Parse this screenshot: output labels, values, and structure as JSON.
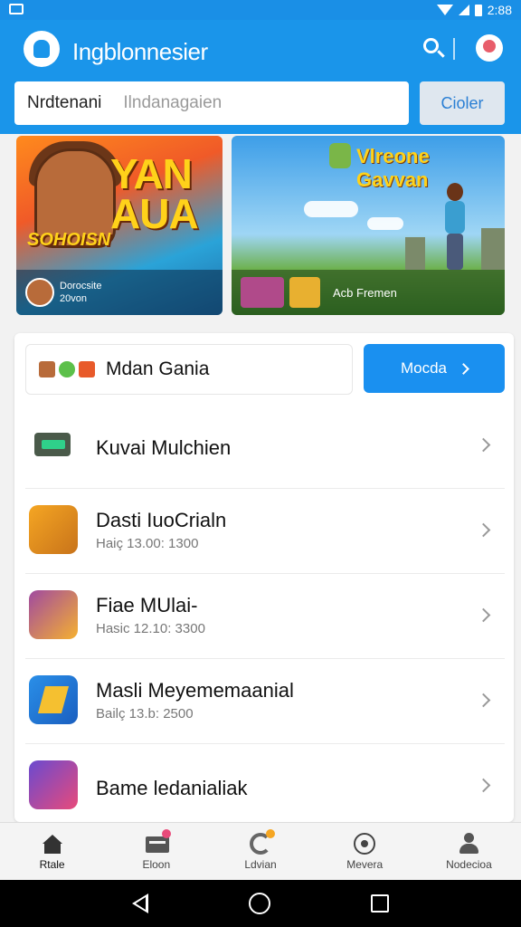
{
  "status_bar": {
    "time": "2:88"
  },
  "app_bar": {
    "title": "Ingblonnesier"
  },
  "search": {
    "label": "Nrdtenani",
    "placeholder": "Ilndanagaien",
    "clear_label": "Cioler"
  },
  "banners": [
    {
      "big_title": "YAN AUA",
      "sub_title": "SOHOISN",
      "stats": [
        "Dorocsite",
        "20von"
      ]
    },
    {
      "title": "Vlreone Gavvan",
      "caption": "Acb Fremen"
    }
  ],
  "feature": {
    "title": "Mdan Gania",
    "more_label": "Mocda"
  },
  "games": [
    {
      "name": "Kuvai Mulchien",
      "meta": ""
    },
    {
      "name": "Dasti IuoCrialn",
      "meta": "Haiç 13.00: 1300"
    },
    {
      "name": "Fiae MUlai-",
      "meta": "Hasic 12.10: 3300"
    },
    {
      "name": "Masli Meyememaanial",
      "meta": "Bailç 13.b: 2500"
    },
    {
      "name": "Bame ledanialiak",
      "meta": ""
    }
  ],
  "bottom_nav": [
    {
      "label": "Rtale",
      "icon": "home-icon"
    },
    {
      "label": "Eloon",
      "icon": "store-icon"
    },
    {
      "label": "Ldvian",
      "icon": "disc-icon"
    },
    {
      "label": "Mevera",
      "icon": "ring-icon"
    },
    {
      "label": "Nodecioa",
      "icon": "profile-icon"
    }
  ],
  "colors": {
    "primary": "#1a95ea",
    "button": "#1a90f0",
    "banner_title": "#ffd21a"
  }
}
